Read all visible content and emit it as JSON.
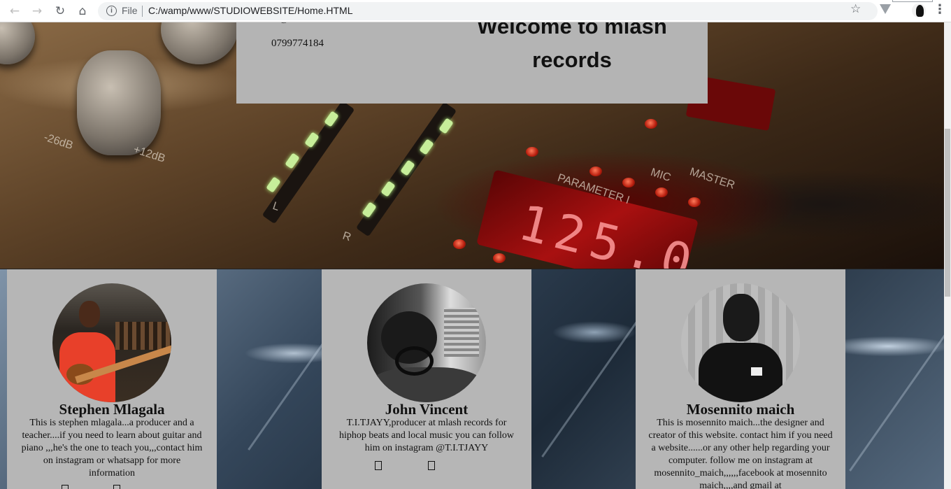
{
  "browser": {
    "file_label": "File",
    "url": "C:/wamp/www/STUDIOWEBSITE/Home.HTML",
    "icons": [
      "back-icon",
      "forward-icon",
      "reload-icon",
      "home-icon",
      "info-icon",
      "star-icon",
      "extension-icon",
      "profile-icon",
      "menu-icon"
    ]
  },
  "header": {
    "contact_top": "...@...",
    "phone": "0799774184",
    "title": "Welcome to mlash records"
  },
  "profiles": [
    {
      "name": "Stephen Mlagala",
      "description": "This is stephen mlagala...a producer and a teacher....if you need to learn about guitar and piano ,,,he's the one to teach you,,,contact him on instagram or whatsapp for more information"
    },
    {
      "name": "John Vincent",
      "description": "T.I.TJAYY,producer at mlash records for hiphop beats and local music you can follow him on instagram @T.I.TJAYY"
    },
    {
      "name": "Mosennito maich",
      "description": "This is mosennito maich...the designer and creator of this website. contact him if you need a website......or any other help regarding your computer. follow me on instagram at mosennito_maich,,,,,,facebook at mosennito maich,,,,and gmail at"
    }
  ],
  "mixer_labels": {
    "parameter": "PARAMETER I",
    "display": "125.0",
    "master": "MASTER",
    "mic": "MIC",
    "left": "L",
    "right": "R",
    "db_low": "-26dB",
    "db_high": "+12dB"
  }
}
